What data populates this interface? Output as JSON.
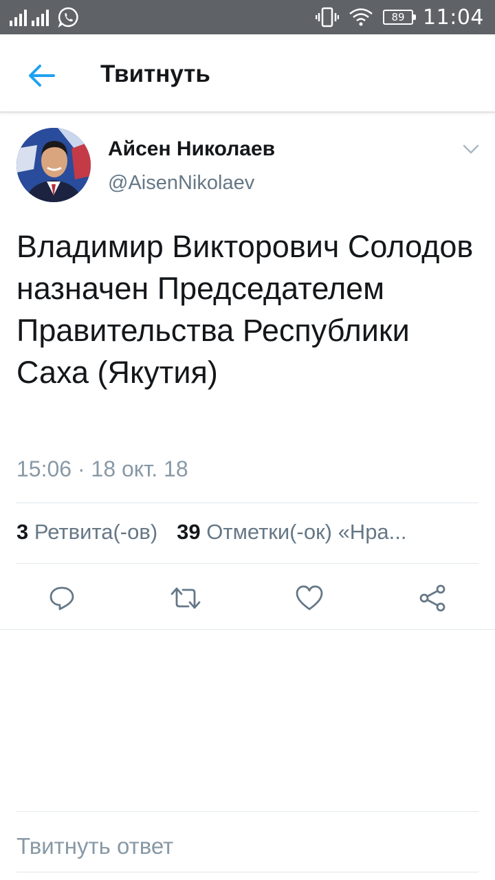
{
  "status_bar": {
    "time": "11:04",
    "battery": "89",
    "icons": [
      "signal-icon",
      "whatsapp-icon",
      "vibrate-icon",
      "wifi-icon",
      "battery-icon"
    ]
  },
  "app_bar": {
    "title": "Твитнуть",
    "back_icon": "arrow-left-icon",
    "accent": "#1da1f2"
  },
  "tweet": {
    "author_name": "Айсен Николаев",
    "author_handle": "@AisenNikolaev",
    "text": "Владимир Викторович Солодов назначен Председателем Правительства Республики Саха (Якутия)",
    "timestamp": "15:06 · 18 окт. 18",
    "retweet_count": "3",
    "retweet_label": "Ретвита(-ов)",
    "like_count": "39",
    "like_label": "Отметки(-ок) «Нра..."
  },
  "actions": [
    "reply-icon",
    "retweet-icon",
    "like-icon",
    "share-icon"
  ],
  "reply_box": {
    "placeholder": "Твитнуть ответ"
  }
}
